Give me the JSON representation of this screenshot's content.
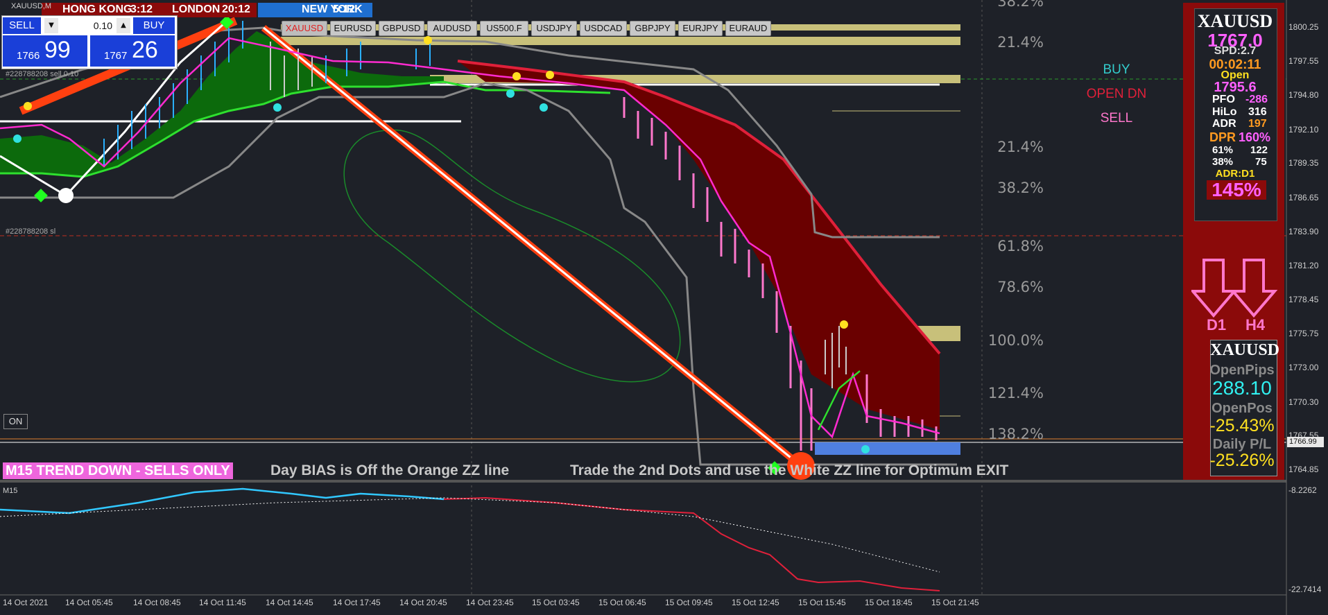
{
  "window": {
    "title": "XAUUSD,M"
  },
  "sessions": [
    {
      "label": "HONG KONG",
      "time": "3:12"
    },
    {
      "label": "LONDON",
      "time": "20:12"
    },
    {
      "label": "NEW YORK",
      "time": "5:12"
    }
  ],
  "trade_panel": {
    "sell_label": "SELL",
    "buy_label": "BUY",
    "lot": "0.10",
    "bid_big": "1766",
    "bid_small": "99",
    "ask_big": "1767",
    "ask_small": "26"
  },
  "symbols": [
    "XAUUSD",
    "EURUSD",
    "GBPUSD",
    "AUDUSD",
    "US500.F",
    "USDJPY",
    "USDCAD",
    "GBPJPY",
    "EURJPY",
    "EURAUD"
  ],
  "order_labels": {
    "sell_order": "#228788208 sell 0.10",
    "sl_order": "#228788208 sl"
  },
  "on_button": "ON",
  "fib_levels": [
    "38.2%",
    "21.4%",
    "21.4%",
    "38.2%",
    "61.8%",
    "78.6%",
    "100.0%",
    "121.4%",
    "138.2%"
  ],
  "signals": {
    "buy": "BUY",
    "open": "OPEN DN",
    "sell": "SELL"
  },
  "colors": {
    "buy": "#33cccc",
    "open": "#e0203a",
    "sell": "#ff77cc",
    "bg": "#1e2128",
    "panel": "#8b0a0a"
  },
  "price_axis": [
    "1800.25",
    "1797.55",
    "1794.80",
    "1792.10",
    "1789.35",
    "1786.65",
    "1783.90",
    "1781.20",
    "1778.45",
    "1775.75",
    "1773.00",
    "1770.30",
    "1767.55",
    "1764.85"
  ],
  "current_price": "1766.99",
  "sub_axis": {
    "top": "-8.2262",
    "bottom": "-22.7414"
  },
  "sub_label": "M15",
  "time_axis": [
    "14 Oct 2021",
    "14 Oct 05:45",
    "14 Oct 08:45",
    "14 Oct 11:45",
    "14 Oct 14:45",
    "14 Oct 17:45",
    "14 Oct 20:45",
    "14 Oct 23:45",
    "15 Oct 03:45",
    "15 Oct 06:45",
    "15 Oct 09:45",
    "15 Oct 12:45",
    "15 Oct 15:45",
    "15 Oct 18:45",
    "15 Oct 21:45"
  ],
  "banner": {
    "trend": "M15  TREND DOWN - SELLS ONLY",
    "bias": "Day BIAS is Off the Orange ZZ line",
    "tip": "Trade the 2nd Dots and use the White ZZ line for Optimum EXIT"
  },
  "stats": {
    "symbol": "XAUUSD",
    "price": "1767.0",
    "spd": "SPD:2.7",
    "timer": "00:02:11",
    "open_label": "Open",
    "open_value": "1795.6",
    "pfo_label": "PFO",
    "pfo_value": "-286",
    "hilo_label": "HiLo",
    "hilo_value": "316",
    "adr_label": "ADR",
    "adr_value": "197",
    "dpr_label": "DPR",
    "dpr_value": "160%",
    "r61_label": "61%",
    "r61_value": "122",
    "r38_label": "38%",
    "r38_value": "75",
    "adr_tf": "ADR:D1",
    "adr_pct": "145%",
    "tf1": "D1",
    "tf2": "H4",
    "symbol2": "XAUUSD",
    "openpips_label": "OpenPips",
    "openpips_value": "288.10",
    "openpos_label": "OpenPos",
    "openpos_value": "-25.43%",
    "daily_label": "Daily P/L",
    "daily_value": "-25.26%"
  }
}
